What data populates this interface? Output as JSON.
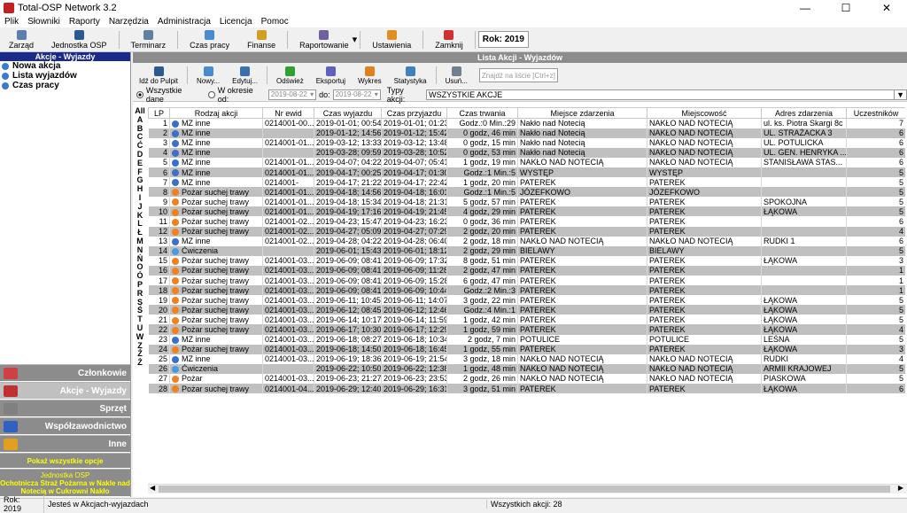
{
  "window": {
    "title": "Total-OSP Network 3.2",
    "min": "—",
    "max": "☐",
    "close": "✕"
  },
  "menu": [
    "Plik",
    "Słowniki",
    "Raporty",
    "Narzędzia",
    "Administracja",
    "Licencja",
    "Pomoc"
  ],
  "toolbar": [
    {
      "label": "Zarząd",
      "icon": "people-icon",
      "color": "#5a7fb0"
    },
    {
      "label": "Jednostka OSP",
      "icon": "building-icon",
      "color": "#2a5a90"
    },
    {
      "label": "Terminarz",
      "icon": "calendar-icon",
      "color": "#6080a0"
    },
    {
      "label": "Czas pracy",
      "icon": "clock-icon",
      "color": "#4a8ad0"
    },
    {
      "label": "Finanse",
      "icon": "coins-icon",
      "color": "#d0a020"
    },
    {
      "label": "Raportowanie",
      "icon": "report-icon",
      "color": "#7060a0"
    },
    {
      "label": "Ustawienia",
      "icon": "gear-icon",
      "color": "#e09020"
    },
    {
      "label": "Zamknij",
      "icon": "power-icon",
      "color": "#d03030"
    }
  ],
  "year": "Rok: 2019",
  "left": {
    "header": "Akcje - Wyjazdy",
    "items": [
      "Nowa akcja",
      "Lista wyjazdów",
      "Czas pracy"
    ],
    "nav": [
      "Członkowie",
      "Akcje - Wyjazdy",
      "Sprzęt",
      "Współzawodnictwo",
      "Inne"
    ],
    "show_all": "Pokaż wszystkie opcje",
    "unit_label": "Jednostka OSP",
    "unit_name": "Ochotnicza Straż Pożarna w Nakle nad Notecią w Cukrowni Nakło"
  },
  "main": {
    "header": "Lista Akcji - Wyjazdów",
    "tools": [
      "Idź do Pulpit",
      "Nowy...",
      "Edytuj...",
      "Odśwież",
      "Eksportuj",
      "Wykres",
      "Statystyka",
      "Usuń..."
    ],
    "search_placeholder": "Znajdź na liście [Ctrl+z]",
    "filter": {
      "all": "Wszystkie dane",
      "period": "W okresie od:",
      "from": "2019-08-22",
      "to_label": "do:",
      "to": "2019-08-22",
      "type_label": "Typy akcji:",
      "type_value": "WSZYSTKIE AKCJE"
    },
    "alphabet": [
      "All",
      "A",
      "B",
      "C",
      "Ć",
      "D",
      "E",
      "F",
      "G",
      "H",
      "I",
      "J",
      "K",
      "L",
      "Ł",
      "M",
      "N",
      "Ń",
      "O",
      "Ó",
      "P",
      "R",
      "S",
      "Ś",
      "T",
      "U",
      "W",
      "Z",
      "Ź",
      "Ż"
    ],
    "columns": [
      "LP",
      "Rodzaj akcji",
      "Nr ewid",
      "Czas wyjazdu",
      "Czas przyjazdu",
      "Czas trwania",
      "Miejsce zdarzenia",
      "Miejscowość",
      "Adres zdarzenia",
      "Uczestników"
    ],
    "rows": [
      [
        "1",
        "MZ inne",
        "0214001-00...",
        "2019-01-01; 00:54",
        "2019-01-01; 01:23",
        "Godz.:0 Min.:29",
        "Nakło nad Notecią",
        "NAKŁO NAD NOTECIĄ",
        "ul. ks. Piotra Skargi 8c",
        "7"
      ],
      [
        "2",
        "MZ inne",
        "",
        "2019-01-12; 14:56",
        "2019-01-12; 15:42",
        "0 godz, 46 min",
        "Nakło nad Notecią",
        "NAKŁO NAD NOTECIĄ",
        "UL. STRAŻACKA 3",
        "6"
      ],
      [
        "3",
        "MZ inne",
        "0214001-01...",
        "2019-03-12; 13:33",
        "2019-03-12; 13:48",
        "0 godz, 15 min",
        "Nakło nad Notecią",
        "NAKŁO NAD NOTECIĄ",
        "UL. POTULICKA",
        "6"
      ],
      [
        "4",
        "MZ inne",
        "",
        "2019-03-28; 09:59",
        "2019-03-28; 10:52",
        "0 godz, 53 min",
        "Nakło nad Notecią",
        "NAKŁO NAD NOTECIĄ",
        "UL. GEN. HENRYKA ...",
        "6"
      ],
      [
        "5",
        "MZ inne",
        "0214001-01...",
        "2019-04-07; 04:22",
        "2019-04-07; 05:41",
        "1 godz, 19 min",
        "NAKŁO NAD NOTECIĄ",
        "NAKŁO NAD NOTECIĄ",
        "STANISŁAWA STAS...",
        "6"
      ],
      [
        "6",
        "MZ inne",
        "0214001-01...",
        "2019-04-17; 00:25",
        "2019-04-17; 01:30",
        "Godz.:1 Min.:5",
        "WYSTĘP",
        "WYSTĘP",
        "",
        "5"
      ],
      [
        "7",
        "MZ inne",
        "0214001-",
        "2019-04-17; 21:22",
        "2019-04-17; 22:42",
        "1 godz, 20 min",
        "PATEREK",
        "PATEREK",
        "",
        "5"
      ],
      [
        "8",
        "Pożar suchej trawy",
        "0214001-01...",
        "2019-04-18; 14:56",
        "2019-04-18; 16:01",
        "Godz.:1 Min.:5",
        "JÓZEFKOWO",
        "JÓZEFKOWO",
        "",
        "5"
      ],
      [
        "9",
        "Pożar suchej trawy",
        "0214001-01...",
        "2019-04-18; 15:34",
        "2019-04-18; 21:31",
        "5 godz, 57 min",
        "PATEREK",
        "PATEREK",
        "SPOKOJNA",
        "5"
      ],
      [
        "10",
        "Pożar suchej trawy",
        "0214001-01...",
        "2019-04-19; 17:16",
        "2019-04-19; 21:45",
        "4 godz, 29 min",
        "PATEREK",
        "PATEREK",
        "ŁĄKOWA",
        "5"
      ],
      [
        "11",
        "Pożar suchej trawy",
        "0214001-02...",
        "2019-04-23; 15:47",
        "2019-04-23; 16:23",
        "0 godz, 36 min",
        "PATEREK",
        "PATEREK",
        "",
        "6"
      ],
      [
        "12",
        "Pożar suchej trawy",
        "0214001-02...",
        "2019-04-27; 05:09",
        "2019-04-27; 07:29",
        "2 godz, 20 min",
        "PATEREK",
        "PATEREK",
        "",
        "4"
      ],
      [
        "13",
        "MZ inne",
        "0214001-02...",
        "2019-04-28; 04:22",
        "2019-04-28; 06:40",
        "2 godz, 18 min",
        "NAKŁO NAD NOTECIĄ",
        "NAKŁO NAD NOTECIĄ",
        "RUDKI 1",
        "6"
      ],
      [
        "14",
        "Ćwiczenia",
        "",
        "2019-06-01; 15:43",
        "2019-06-01; 18:12",
        "2 godz, 29 min",
        "BIELAWY",
        "BIELAWY",
        "",
        "5"
      ],
      [
        "15",
        "Pożar suchej trawy",
        "0214001-03...",
        "2019-06-09; 08:41",
        "2019-06-09; 17:32",
        "8 godz, 51 min",
        "PATEREK",
        "PATEREK",
        "ŁĄKOWA",
        "3"
      ],
      [
        "16",
        "Pożar suchej trawy",
        "0214001-03...",
        "2019-06-09; 08:41",
        "2019-06-09; 11:28",
        "2 godz, 47 min",
        "PATEREK",
        "PATEREK",
        "",
        "1"
      ],
      [
        "17",
        "Pożar suchej trawy",
        "0214001-03...",
        "2019-06-09; 08:41",
        "2019-06-09; 15:28",
        "6 godz, 47 min",
        "PATEREK",
        "PATEREK",
        "",
        "1"
      ],
      [
        "18",
        "Pożar suchej trawy",
        "0214001-03...",
        "2019-06-09; 08:41",
        "2019-06-09; 10:44",
        "Godz.:2 Min.:3",
        "PATEREK",
        "PATEREK",
        "",
        "1"
      ],
      [
        "19",
        "Pożar suchej trawy",
        "0214001-03...",
        "2019-06-11; 10:45",
        "2019-06-11; 14:07",
        "3 godz, 22 min",
        "PATEREK",
        "PATEREK",
        "ŁĄKOWA",
        "5"
      ],
      [
        "20",
        "Pożar suchej trawy",
        "0214001-03...",
        "2019-06-12; 08:45",
        "2019-06-12; 12:46",
        "Godz.:4 Min.:1",
        "PATEREK",
        "PATEREK",
        "ŁĄKOWA",
        "5"
      ],
      [
        "21",
        "Pożar suchej trawy",
        "0214001-03...",
        "2019-06-14; 10:17",
        "2019-06-14; 11:59",
        "1 godz, 42 min",
        "PATEREK",
        "PATEREK",
        "ŁĄKOWA",
        "5"
      ],
      [
        "22",
        "Pożar suchej trawy",
        "0214001-03...",
        "2019-06-17; 10:30",
        "2019-06-17; 12:29",
        "1 godz, 59 min",
        "PATEREK",
        "PATEREK",
        "ŁĄKOWA",
        "4"
      ],
      [
        "23",
        "MZ inne",
        "0214001-03...",
        "2019-06-18; 08:27",
        "2019-06-18; 10:34",
        "2 godz, 7 min",
        "POTULICE",
        "POTULICE",
        "LEŚNA",
        "5"
      ],
      [
        "24",
        "Pożar suchej trawy",
        "0214001-03...",
        "2019-06-18; 14:50",
        "2019-06-18; 16:45",
        "1 godz, 55 min",
        "PATEREK",
        "PATEREK",
        "ŁĄKOWA",
        "3"
      ],
      [
        "25",
        "MZ inne",
        "0214001-03...",
        "2019-06-19; 18:36",
        "2019-06-19; 21:54",
        "3 godz, 18 min",
        "NAKŁO NAD NOTECIĄ",
        "NAKŁO NAD NOTECIĄ",
        "RUDKI",
        "4"
      ],
      [
        "26",
        "Ćwiczenia",
        "",
        "2019-06-22; 10:50",
        "2019-06-22; 12:38",
        "1 godz, 48 min",
        "NAKŁO NAD NOTECIĄ",
        "NAKŁO NAD NOTECIĄ",
        "ARMII KRAJOWEJ",
        "5"
      ],
      [
        "27",
        "Pożar",
        "0214001-03...",
        "2019-06-23; 21:27",
        "2019-06-23; 23:53",
        "2 godz, 26 min",
        "NAKŁO NAD NOTECIĄ",
        "NAKŁO NAD NOTECIĄ",
        "PIASKOWA",
        "5"
      ],
      [
        "28",
        "Pożar suchej trawy",
        "0214001-04...",
        "2019-06-29; 12:40",
        "2019-06-29; 16:31",
        "3 godz, 51 min",
        "PATEREK",
        "PATEREK",
        "ŁĄKOWA",
        "6"
      ]
    ]
  },
  "status": {
    "year": "Rok: 2019",
    "location": "Jesteś w Akcjach-wyjazdach",
    "count": "Wszystkich akcji: 28"
  }
}
